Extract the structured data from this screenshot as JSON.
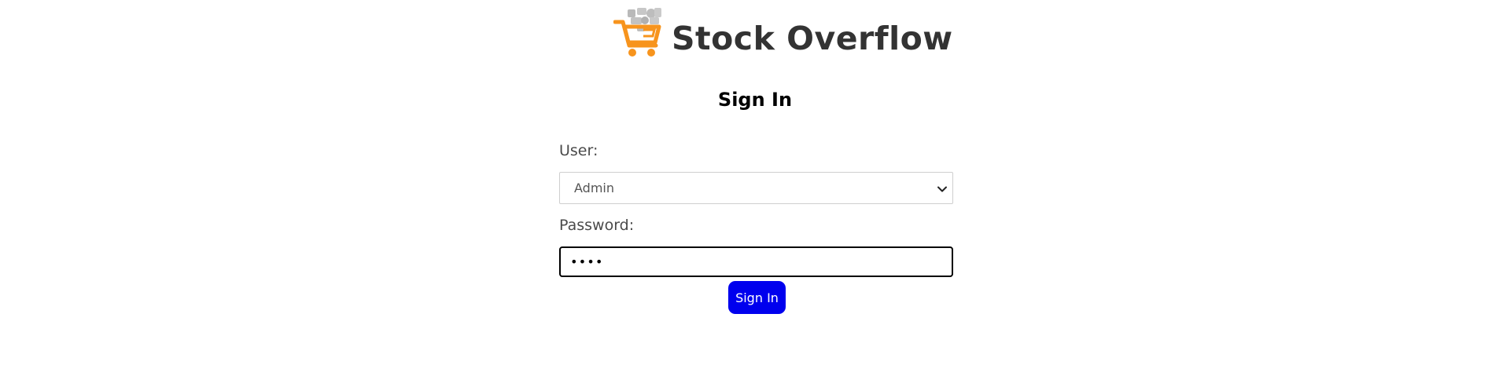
{
  "header": {
    "brand_name": "Stock Overflow",
    "logo_icon": "shopping-cart-icon",
    "colors": {
      "cart": "#f7941d",
      "text": "#333333"
    }
  },
  "title": "Sign In",
  "form": {
    "user_label": "User:",
    "user_selected": "Admin",
    "password_label": "Password:",
    "password_masked": "••••"
  },
  "button": {
    "label": "Sign In",
    "color": "#0000ee"
  }
}
